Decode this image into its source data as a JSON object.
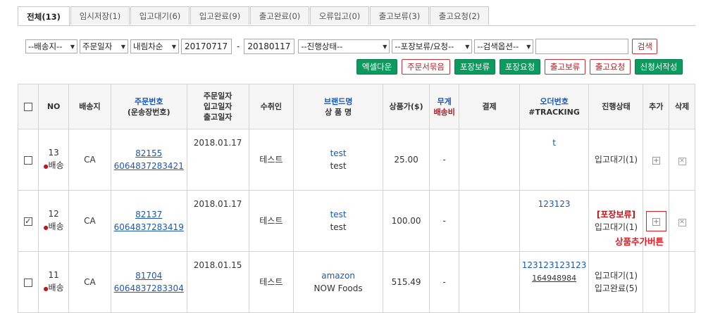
{
  "tabs": [
    {
      "label": "전체(13)",
      "active": true
    },
    {
      "label": "임시저장(1)",
      "active": false
    },
    {
      "label": "입고대기(6)",
      "active": false
    },
    {
      "label": "입고완료(9)",
      "active": false
    },
    {
      "label": "출고완료(0)",
      "active": false
    },
    {
      "label": "오류입고(0)",
      "active": false
    },
    {
      "label": "출고보류(3)",
      "active": false
    },
    {
      "label": "출고요청(2)",
      "active": false
    }
  ],
  "filters": {
    "ship_to": "--배송지--",
    "date_type": "주문일자",
    "sort": "내림차순",
    "date_from": "20170717",
    "date_sep": "-",
    "date_to": "20180117",
    "progress": "--진행상태--",
    "packing": "--포장보류/요청--",
    "search_option": "--검색옵션--",
    "search_value": "",
    "search_button": "검색"
  },
  "actions": {
    "excel": "엑셀다운",
    "order_bundle": "주문서묶음",
    "pack_hold": "포장보류",
    "pack_request": "포장요청",
    "ship_hold": "출고보류",
    "ship_request": "출고요청",
    "application": "신청서작성"
  },
  "columns": {
    "no": "NO",
    "ship_to": "배송지",
    "order_no": "주문번호",
    "order_no_sub": "(운송장번호)",
    "dates_1": "주문일자",
    "dates_2": "입고일자",
    "dates_3": "출고일자",
    "recipient": "수취인",
    "brand": "브랜드명",
    "product": "상 품 명",
    "price": "상품가($)",
    "weight": "무게",
    "shipping_fee": "배송비",
    "payment": "결제",
    "order_id": "오더번호",
    "tracking": "#TRACKING",
    "status": "진행상태",
    "add": "추가",
    "delete": "삭제"
  },
  "rows": [
    {
      "checked": false,
      "no": "13",
      "tag": "배송",
      "ship_to": "CA",
      "order_no": "82155",
      "waybill": "6064837283421",
      "date": "2018.01.17",
      "recipient": "테스트",
      "brand": "test",
      "product": "test",
      "price": "25.00",
      "weight": "-",
      "payment": "",
      "order_id": "t",
      "tracking": "",
      "status_hold": "",
      "status": [
        "입고대기(1)"
      ]
    },
    {
      "checked": true,
      "no": "12",
      "tag": "배송",
      "ship_to": "CA",
      "order_no": "82137",
      "waybill": "6064837283419",
      "date": "2018.01.17",
      "recipient": "테스트",
      "brand": "test",
      "product": "test",
      "price": "100.00",
      "weight": "-",
      "payment": "",
      "order_id": "123123",
      "tracking": "",
      "status_hold": "[포장보류]",
      "status": [
        "입고대기(1)"
      ]
    },
    {
      "checked": false,
      "no": "11",
      "tag": "배송",
      "ship_to": "CA",
      "order_no": "81704",
      "waybill": "6064837283304",
      "date": "2018.01.15",
      "recipient": "테스트",
      "brand": "amazon",
      "product": "NOW Foods",
      "price": "515.49",
      "weight": "-",
      "payment": "",
      "order_id": "123123123123",
      "tracking": "164948984",
      "status_hold": "",
      "status": [
        "입고대기(1)",
        "입고완료(5)"
      ]
    }
  ],
  "annotation": "상품추가버튼"
}
